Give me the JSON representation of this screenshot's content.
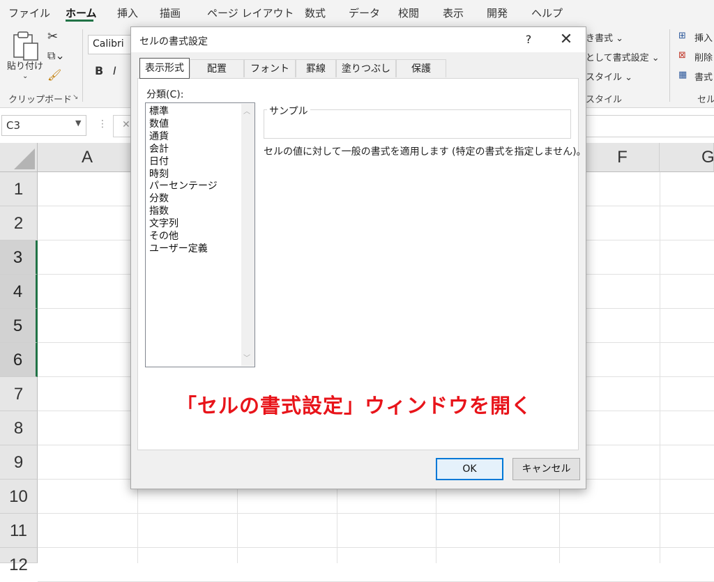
{
  "menu": {
    "items": [
      "ファイル",
      "ホーム",
      "挿入",
      "描画",
      "ページ レイアウト",
      "数式",
      "データ",
      "校閲",
      "表示",
      "開発",
      "ヘルプ"
    ],
    "active_index": 1
  },
  "ribbon": {
    "paste_label": "貼り付け",
    "clipboard_group": "クリップボード",
    "font_name": "Calibri",
    "bold": "B",
    "italic": "I",
    "cond_format": "き書式 ⌄",
    "table_format": "として書式設定 ⌄",
    "cell_style": "スタイル ⌄",
    "style_group": "スタイル",
    "insert": "挿入",
    "delete": "削除",
    "format": "書式",
    "cells_group": "セル"
  },
  "formula_bar": {
    "name_box": "C3"
  },
  "grid": {
    "columns": [
      "A",
      "F",
      "G"
    ],
    "rows": [
      "1",
      "2",
      "3",
      "4",
      "5",
      "6",
      "7",
      "8",
      "9",
      "10",
      "11",
      "12"
    ],
    "selected_rows": [
      "3",
      "4",
      "5",
      "6"
    ]
  },
  "dialog": {
    "title": "セルの書式設定",
    "help": "?",
    "close": "✕",
    "tabs": [
      "表示形式",
      "配置",
      "フォント",
      "罫線",
      "塗りつぶし",
      "保護"
    ],
    "active_tab": 0,
    "category_label": "分類(C):",
    "categories": [
      "標準",
      "数値",
      "通貨",
      "会計",
      "日付",
      "時刻",
      "パーセンテージ",
      "分数",
      "指数",
      "文字列",
      "その他",
      "ユーザー定義"
    ],
    "sample_label": "サンプル",
    "description": "セルの値に対して一般の書式を適用します (特定の書式を指定しません)。",
    "ok": "OK",
    "cancel": "キャンセル"
  },
  "annotation": "「セルの書式設定」ウィンドウを開く",
  "colors": {
    "accent": "#217346",
    "annotation": "#e8141a",
    "ok_border": "#0078d7"
  }
}
